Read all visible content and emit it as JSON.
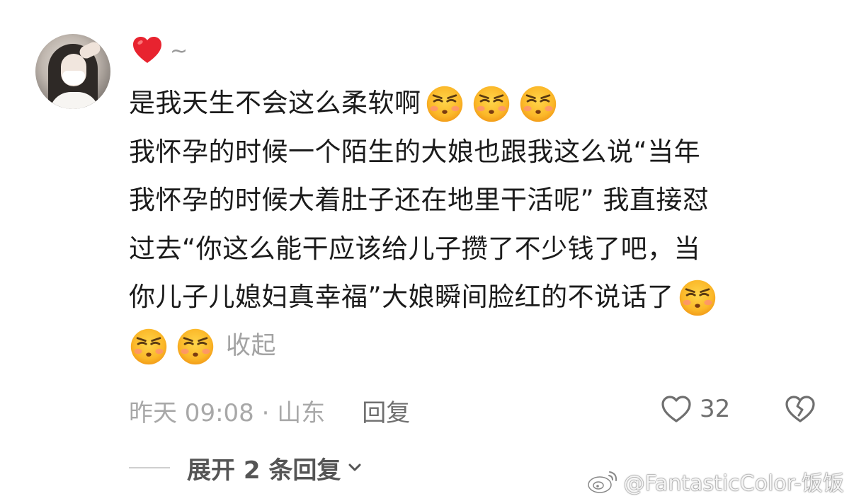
{
  "comment": {
    "name_suffix": "~",
    "lines": [
      "是我天生不会这么柔软啊",
      "我怀孕的时候一个陌生的大娘也跟我这么说“当年",
      "我怀孕的时候大着肚子还在地里干活呢” 我直接怼",
      "过去“你这么能干应该给儿子攒了不少钱了吧，当",
      "你儿子儿媳妇真幸福”大娘瞬间脸红的不说话了"
    ],
    "collapse_label": "收起",
    "emoji_name": "smirk-face-emoji"
  },
  "meta": {
    "time_location": "昨天 09:08 · 山东",
    "reply_label": "回复",
    "like_count": "32"
  },
  "replies": {
    "expand_label": "展开 2 条回复"
  },
  "watermark": {
    "text": "@FantasticColor-饭饭"
  },
  "colors": {
    "heart": "#e8232f",
    "text_primary": "#1b1b1b",
    "text_muted": "#a8a8a8",
    "emoji_face": "#fbb829"
  }
}
